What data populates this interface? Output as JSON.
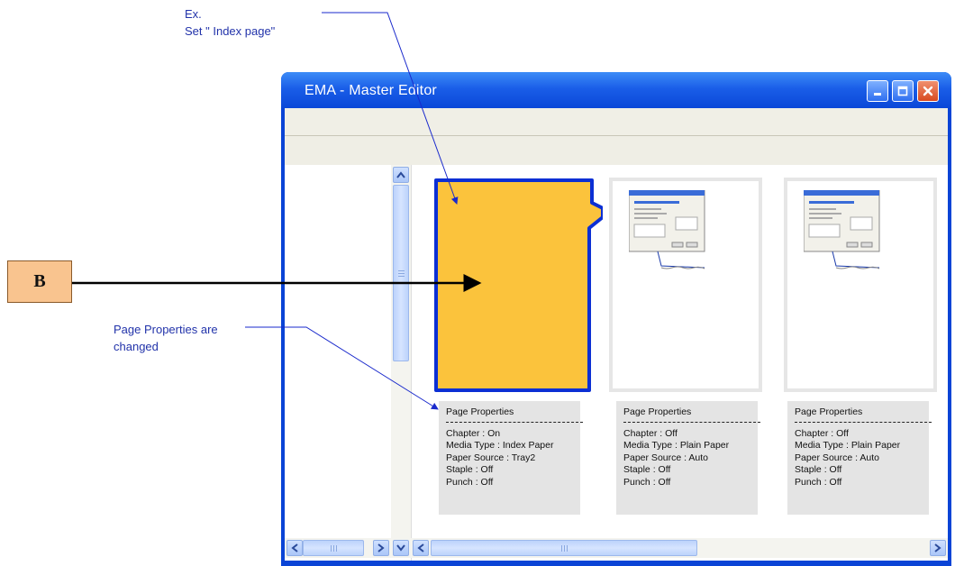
{
  "annotations": {
    "example_line1": "Ex.",
    "example_line2": "Set \" Index page\"",
    "marker_label": "B",
    "changed_line1": "Page Properties are",
    "changed_line2": "changed"
  },
  "window": {
    "title": "EMA - Master Editor",
    "buttons": [
      "minimize",
      "maximize",
      "close"
    ]
  },
  "pages": [
    {
      "type": "index-tab",
      "fill_color": "#fbc33c",
      "border_color": "#0b2fd4",
      "properties": {
        "heading": "Page Properties",
        "chapter": "Chapter : On",
        "media_type": "Media Type : Index Paper",
        "paper_source": "Paper Source : Tray2",
        "staple": "Staple : Off",
        "punch": "Punch : Off"
      }
    },
    {
      "type": "document",
      "properties": {
        "heading": "Page Properties",
        "chapter": "Chapter : Off",
        "media_type": "Media Type : Plain Paper",
        "paper_source": "Paper Source : Auto",
        "staple": "Staple : Off",
        "punch": "Punch : Off"
      }
    },
    {
      "type": "document",
      "properties": {
        "heading": "Page Properties",
        "chapter": "Chapter : Off",
        "media_type": "Media Type : Plain Paper",
        "paper_source": "Paper Source : Auto",
        "staple": "Staple : Off",
        "punch": "Punch : Off"
      }
    }
  ],
  "colors": {
    "annotation_text": "#2233aa",
    "title_bar": "#1a5ee8",
    "marker_fill": "#f9c48f"
  }
}
